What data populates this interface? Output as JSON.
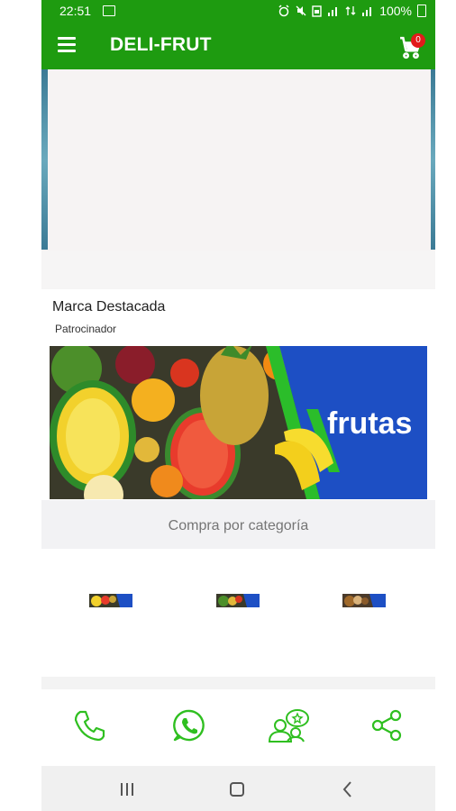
{
  "status_bar": {
    "time": "22:51",
    "battery": "100%"
  },
  "app_bar": {
    "title": "DELI-FRUT",
    "cart_count": "0"
  },
  "featured": {
    "title": "Marca Destacada",
    "sponsor_label": "Patrocinador",
    "banner_text": "frutas"
  },
  "categories": {
    "header": "Compra por categoría",
    "items": [
      "category-1",
      "category-2",
      "category-3"
    ]
  },
  "bottom_actions": [
    "phone-icon",
    "whatsapp-icon",
    "contacts-icon",
    "share-icon"
  ],
  "colors": {
    "primary": "#1e9b10",
    "accent_icons": "#2fbf20",
    "badge": "#e21b1b",
    "banner_blue": "#1d4fc4"
  }
}
